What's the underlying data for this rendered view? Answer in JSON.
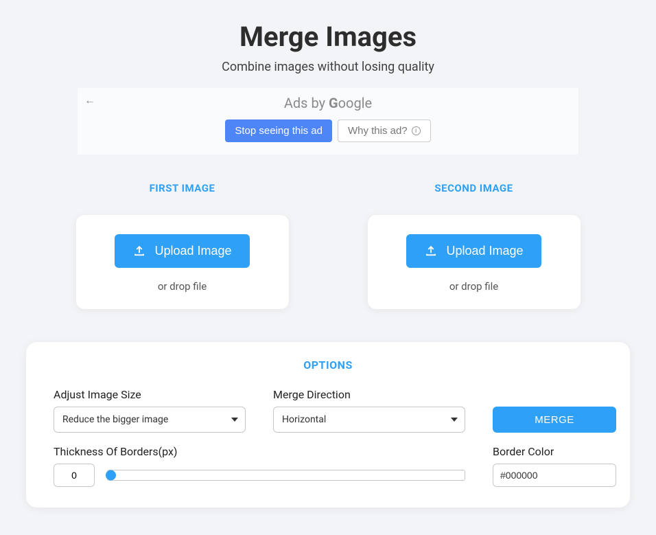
{
  "header": {
    "title": "Merge Images",
    "subtitle": "Combine images without losing quality"
  },
  "ad": {
    "ads_by_prefix": "Ads by ",
    "google": "Google",
    "stop_label": "Stop seeing this ad",
    "why_label": "Why this ad?"
  },
  "uploads": [
    {
      "label": "FIRST IMAGE",
      "button_label": "Upload Image",
      "drop_text": "or drop file"
    },
    {
      "label": "SECOND IMAGE",
      "button_label": "Upload Image",
      "drop_text": "or drop file"
    }
  ],
  "options": {
    "title": "OPTIONS",
    "adjust_label": "Adjust Image Size",
    "adjust_value": "Reduce the bigger image",
    "direction_label": "Merge Direction",
    "direction_value": "Horizontal",
    "merge_button": "MERGE",
    "thickness_label": "Thickness Of Borders(px)",
    "thickness_value": "0",
    "border_color_label": "Border Color",
    "border_color_value": "#000000"
  }
}
